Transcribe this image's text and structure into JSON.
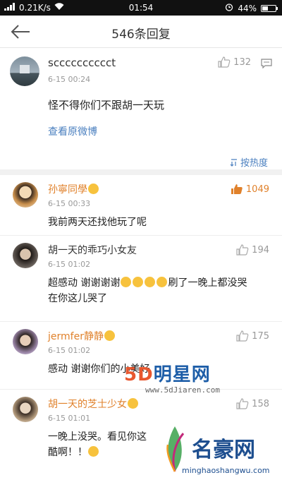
{
  "status_bar": {
    "speed": "0.21K/s",
    "time": "01:54",
    "battery": "44%"
  },
  "nav": {
    "title": "546条回复"
  },
  "main_post": {
    "username": "scccccccccct",
    "time": "6-15 00:24",
    "text": "怪不得你们不跟胡一天玩",
    "link": "查看原微博",
    "likes": "132",
    "sort_label": "按热度"
  },
  "comments": [
    {
      "name": "孙寧同學",
      "time": "6-15 00:33",
      "text": "我前两天还找他玩了呢",
      "likes": "1049"
    },
    {
      "name": "胡一天的乖巧小女友",
      "time": "6-15 01:02",
      "text_a": "超感动 谢谢谢谢",
      "text_b": "刷了一晚上都没哭",
      "text_c": "在你这儿哭了",
      "likes": "194"
    },
    {
      "name": "jermfer静静",
      "time": "6-15 01:02",
      "text": "感动  谢谢你们的小美好",
      "likes": "175"
    },
    {
      "name": "胡一天的芝士少女",
      "time": "6-15 01:01",
      "text_a": "一晚上没哭。看见你这",
      "text_b": "酷啊！！",
      "likes": "158"
    }
  ],
  "watermarks": {
    "fived_brand": "5D",
    "fived_cn": "明星网",
    "fived_url": "www.5dJiaren.com",
    "mh_cn": "名豪网",
    "mh_url": "minghaoshangwu.com"
  },
  "colors": {
    "link": "#4a7fbf",
    "highlight": "#e0812b"
  }
}
